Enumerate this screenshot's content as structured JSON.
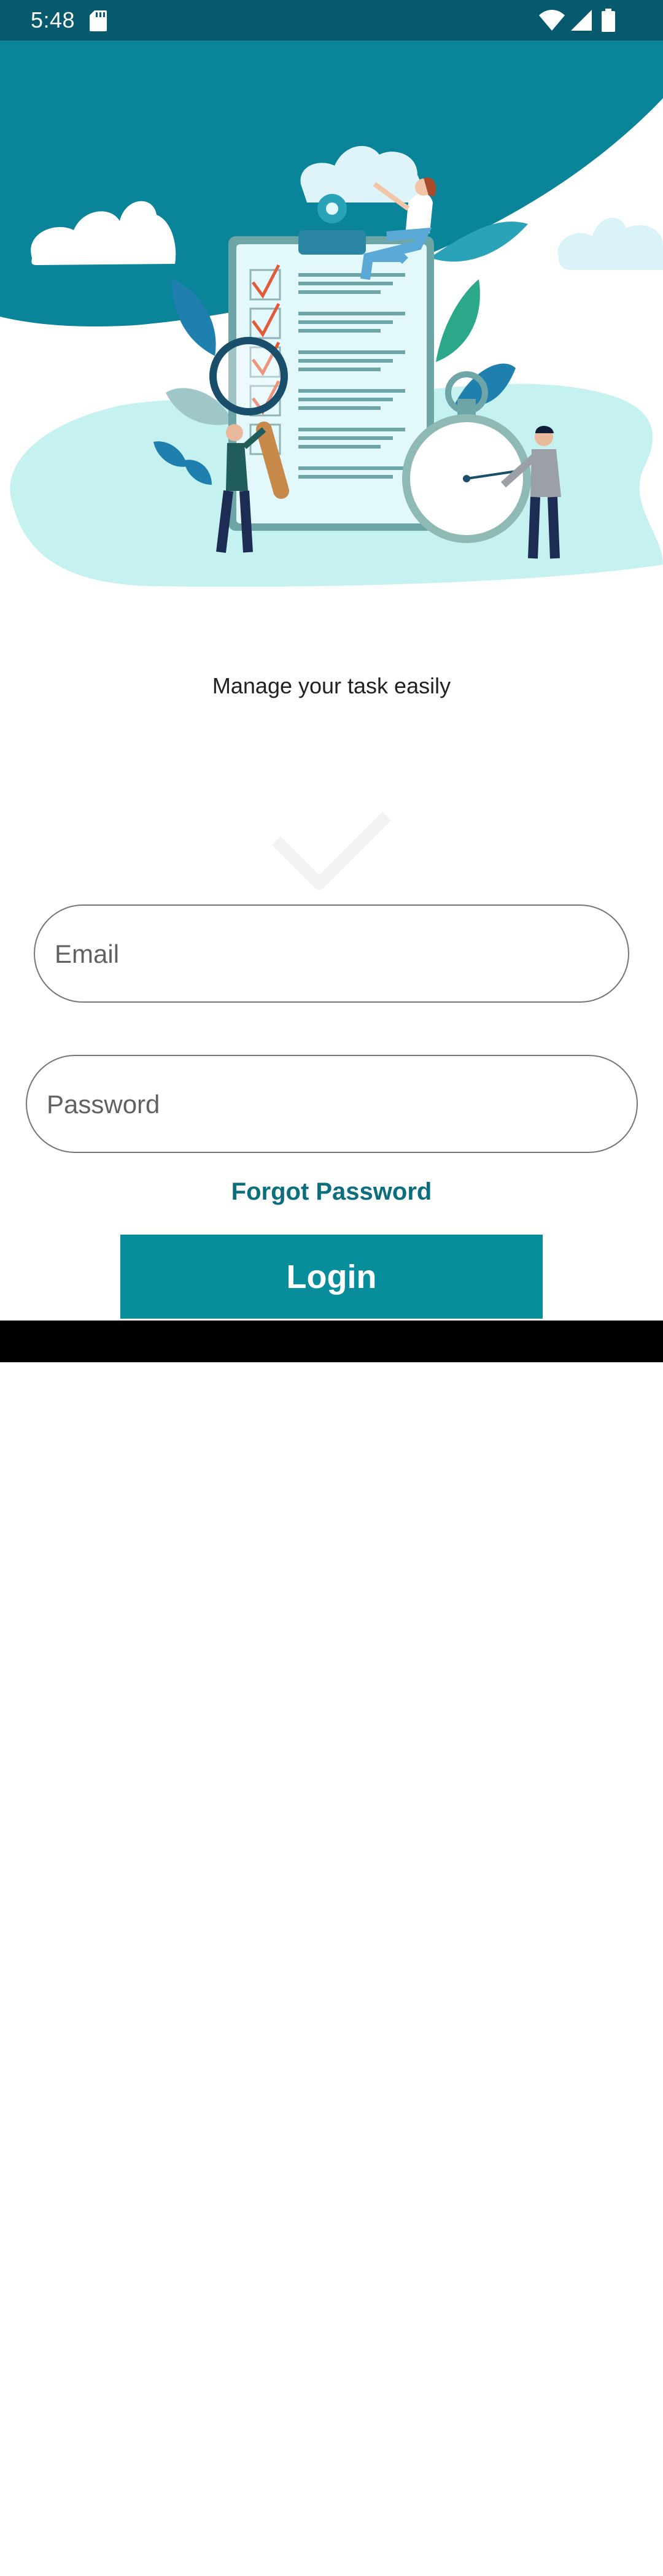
{
  "status_bar": {
    "time": "5:48",
    "icons": [
      "sd-card-icon",
      "wifi-icon",
      "cell-signal-icon",
      "battery-icon"
    ]
  },
  "hero": {
    "description_icons": [
      "clipboard-checklist",
      "magnifying-glass",
      "stopwatch"
    ]
  },
  "tagline": "Manage your task easily",
  "form": {
    "email_placeholder": "Email",
    "email_value": "",
    "password_placeholder": "Password",
    "password_value": ""
  },
  "forgot_password_label": "Forgot Password",
  "login_label": "Login",
  "colors": {
    "status_bar": "#075a6e",
    "hero_teal": "#098499",
    "accent": "#088e9a",
    "link": "#0b6e7c"
  }
}
